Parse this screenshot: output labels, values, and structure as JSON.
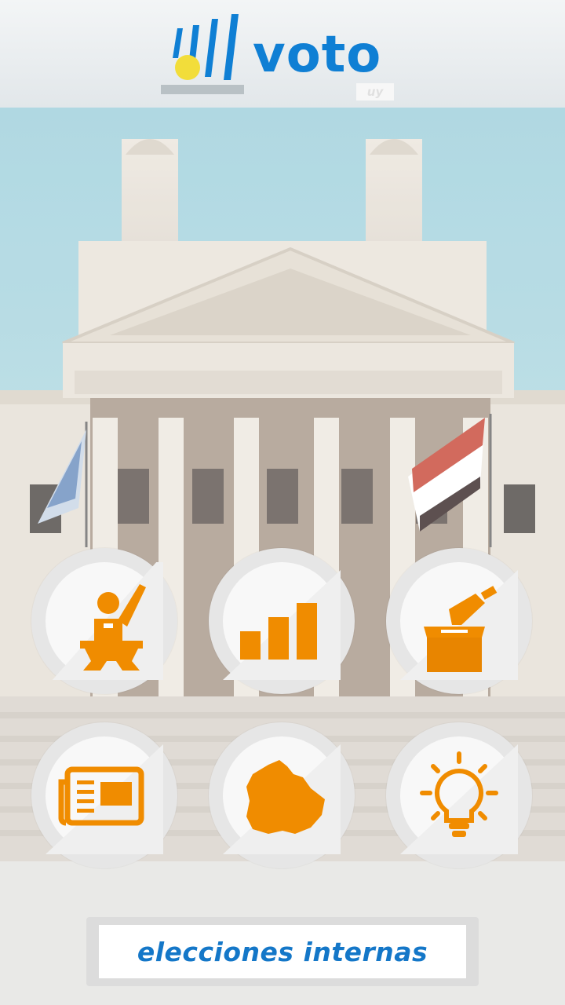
{
  "header": {
    "logo_word": "voto",
    "logo_sub": "uy"
  },
  "menu": {
    "items": [
      {
        "name": "candidates",
        "icon": "candidate-podium-icon"
      },
      {
        "name": "results",
        "icon": "bar-chart-icon"
      },
      {
        "name": "how-to-vote",
        "icon": "ballot-box-icon"
      },
      {
        "name": "news",
        "icon": "newspaper-icon"
      },
      {
        "name": "map",
        "icon": "uruguay-map-icon"
      },
      {
        "name": "info",
        "icon": "lightbulb-icon"
      }
    ]
  },
  "banner": {
    "label": "elecciones internas"
  },
  "colors": {
    "accent": "#f08c00",
    "brand": "#0f7fd4",
    "sky": "#a9d5e0"
  }
}
